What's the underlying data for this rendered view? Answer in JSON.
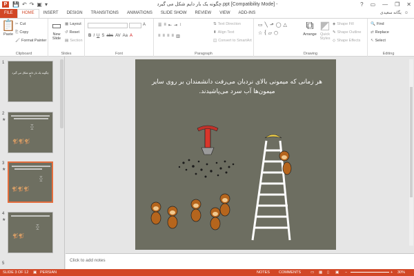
{
  "window": {
    "title": "چگونه یک بار دایم شکل می گیرد.ppt [Compatibility Mode] - PowerPoint",
    "controls": [
      "?",
      "▭",
      "—",
      "❐",
      "✕"
    ]
  },
  "tabs": [
    "FILE",
    "HOME",
    "INSERT",
    "DESIGN",
    "TRANSITIONS",
    "ANIMATIONS",
    "SLIDE SHOW",
    "REVIEW",
    "VIEW",
    "ADD-INS"
  ],
  "active_tab": "HOME",
  "user": {
    "name": "یگانه سعیدی"
  },
  "ribbon": {
    "clipboard": {
      "paste": "Paste",
      "cut": "Cut",
      "copy": "Copy",
      "format_painter": "Format Painter",
      "label": "Clipboard"
    },
    "slides": {
      "new_slide": "New Slide",
      "layout": "Layout",
      "reset": "Reset",
      "section": "Section",
      "label": "Slides"
    },
    "font": {
      "label": "Font"
    },
    "paragraph": {
      "text_direction": "Text Direction",
      "align_text": "Align Text",
      "convert_smartart": "Convert to SmartArt",
      "label": "Paragraph"
    },
    "drawing": {
      "arrange": "Arrange",
      "quick_styles": "Quick Styles",
      "shape_fill": "Shape Fill",
      "shape_outline": "Shape Outline",
      "shape_effects": "Shape Effects",
      "label": "Drawing"
    },
    "editing": {
      "find": "Find",
      "replace": "Replace",
      "select": "Select",
      "label": "Editing"
    }
  },
  "thumbnails": [
    {
      "num": "1",
      "text": "چگونه یک بار دایم شکل می گیرد ؟",
      "selected": false
    },
    {
      "num": "2",
      "text": "",
      "selected": false
    },
    {
      "num": "3",
      "text": "",
      "selected": true
    },
    {
      "num": "4",
      "text": "",
      "selected": false
    },
    {
      "num": "5",
      "text": "",
      "selected": false
    }
  ],
  "slide": {
    "title": "هر زمانی که میمونی بالای نردبان می‌رفت دانشمندان بر روی سایر میمون‌ها آب سرد می‌پاشیدند.",
    "background": "#6d6e61"
  },
  "notes": {
    "placeholder": "Click to add notes"
  },
  "status": {
    "slide_info": "SLIDE 3 OF 12",
    "language": "PERSIAN",
    "notes_btn": "NOTES",
    "comments_btn": "COMMENTS",
    "zoom": "30%"
  },
  "colors": {
    "accent": "#d24726",
    "slide_bg": "#6d6e61"
  }
}
